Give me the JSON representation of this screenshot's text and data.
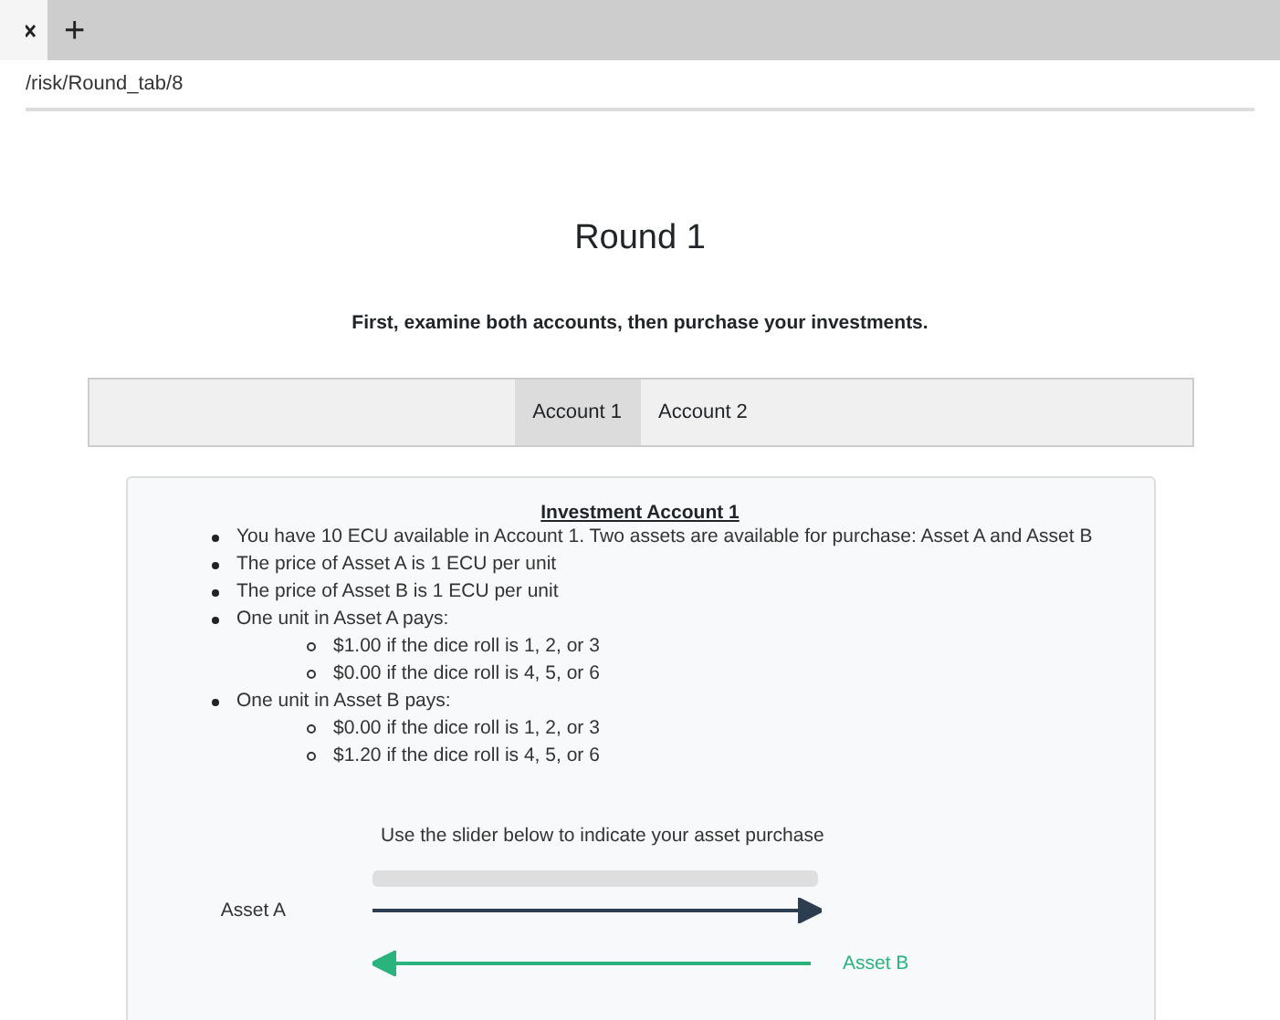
{
  "browser": {
    "url": "/risk/Round_tab/8",
    "new_tab": "+"
  },
  "title": "Round 1",
  "instruction": "First, examine both accounts, then purchase your investments.",
  "tabs": [
    {
      "label": "Account 1",
      "selected": true
    },
    {
      "label": "Account 2",
      "selected": false
    }
  ],
  "account": {
    "heading": "Investment Account 1",
    "items": [
      {
        "text": "You have 10 ECU available in Account 1. Two assets are available for purchase: Asset A and Asset B"
      },
      {
        "text": "The price of Asset A is 1 ECU per unit"
      },
      {
        "text": "The price of Asset B is 1 ECU per unit"
      },
      {
        "text": "One unit in Asset A pays:",
        "children": [
          {
            "text": "$1.00 if the dice roll is 1, 2, or 3"
          },
          {
            "text": "$0.00 if the dice roll is 4, 5, or 6"
          }
        ]
      },
      {
        "text": "One unit in Asset B pays:",
        "children": [
          {
            "text": "$0.00 if the dice roll is 1, 2, or 3"
          },
          {
            "text": "$1.20 if the dice roll is 4, 5, or 6"
          }
        ]
      }
    ],
    "slider_prompt": "Use the slider below to indicate your asset purchase",
    "left_label": "Asset A",
    "right_label": "Asset B"
  }
}
